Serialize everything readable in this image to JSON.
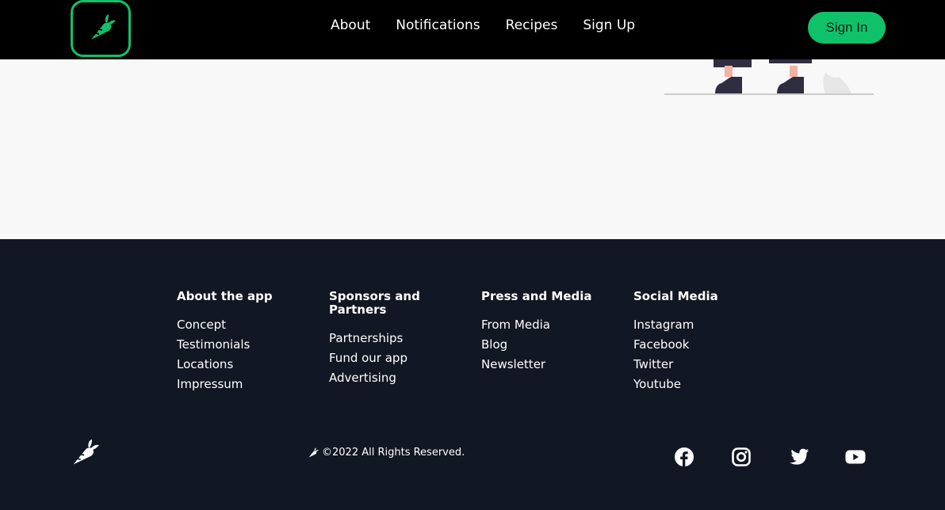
{
  "nav": {
    "links": [
      "About",
      "Notifications",
      "Recipes",
      "Sign Up"
    ],
    "signin_label": "Sign In",
    "logo_icon": "carrot-icon"
  },
  "colors": {
    "accent": "#0fc26a",
    "nav_bg": "#000000",
    "footer_bg": "#111723",
    "page_bg": "#f8f8f8"
  },
  "footer": {
    "columns": [
      {
        "title": "About the app",
        "links": [
          "Concept",
          "Testimonials",
          "Locations",
          "Impressum"
        ]
      },
      {
        "title": "Sponsors and Partners",
        "links": [
          "Partnerships",
          "Fund our app",
          "Advertising"
        ]
      },
      {
        "title": "Press and Media",
        "links": [
          "From Media",
          "Blog",
          "Newsletter"
        ]
      },
      {
        "title": "Social Media",
        "links": [
          "Instagram",
          "Facebook",
          "Twitter",
          "Youtube"
        ]
      }
    ],
    "copyright": "©2022 All Rights Reserved.",
    "social_icons": [
      "facebook-icon",
      "instagram-icon",
      "twitter-icon",
      "youtube-icon"
    ]
  }
}
